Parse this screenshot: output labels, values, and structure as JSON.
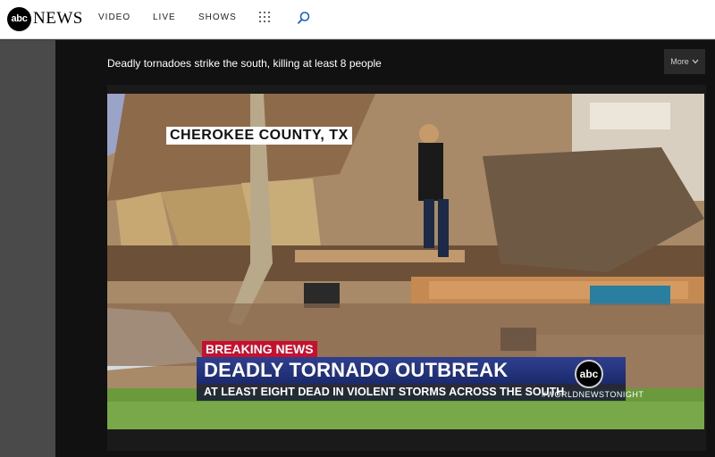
{
  "header": {
    "logo_badge": "abc",
    "logo_word": "NEWS",
    "nav": [
      {
        "label": "VIDEO"
      },
      {
        "label": "LIVE"
      },
      {
        "label": "SHOWS"
      }
    ],
    "icons": [
      "grid-menu-icon",
      "search-icon"
    ]
  },
  "player": {
    "title": "Deadly tornadoes strike the south, killing at least 8 people",
    "more_label": "More"
  },
  "broadcast": {
    "location": "CHEROKEE COUNTY, TX",
    "breaking": "BREAKING NEWS",
    "headline": "DEADLY TORNADO OUTBREAK",
    "subline": "AT LEAST EIGHT DEAD IN VIOLENT STORMS ACROSS THE SOUTH",
    "bug": "abc",
    "hashtag": "#WORLDNEWSTONIGHT"
  },
  "colors": {
    "breaking_red": "#c8102e",
    "headline_blue": "#1b2a6b",
    "panel_dark": "#111111"
  }
}
